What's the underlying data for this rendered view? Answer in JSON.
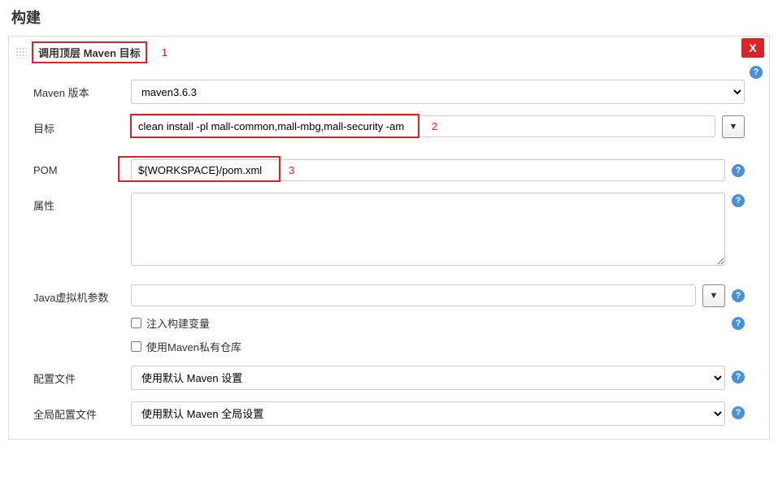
{
  "page": {
    "title": "构建"
  },
  "section": {
    "header_title": "调用顶层 Maven 目标",
    "annot1": "1",
    "close": "X"
  },
  "form": {
    "maven_version": {
      "label": "Maven 版本",
      "value": "maven3.6.3"
    },
    "goals": {
      "label": "目标",
      "value": "clean install -pl mall-common,mall-mbg,mall-security -am",
      "annot": "2"
    },
    "pom": {
      "label": "POM",
      "value": "${WORKSPACE}/pom.xml",
      "annot": "3"
    },
    "properties": {
      "label": "属性",
      "value": ""
    },
    "jvm": {
      "label": "Java虚拟机参数",
      "value": ""
    },
    "inject": {
      "label": "注入构建变量"
    },
    "private_repo": {
      "label": "使用Maven私有仓库"
    },
    "settings": {
      "label": "配置文件",
      "value": "使用默认 Maven 设置"
    },
    "global_settings": {
      "label": "全局配置文件",
      "value": "使用默认 Maven 全局设置"
    }
  },
  "icons": {
    "help": "?",
    "down": "▼"
  }
}
